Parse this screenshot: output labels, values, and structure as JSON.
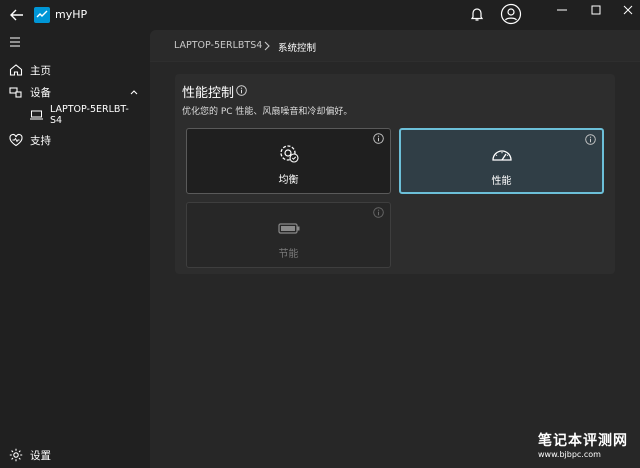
{
  "app": {
    "name": "myHP"
  },
  "sidebar": {
    "items": [
      {
        "label": "主页",
        "icon": "home-icon"
      },
      {
        "label": "设备",
        "icon": "devices-icon"
      },
      {
        "label": "支持",
        "icon": "support-heart-icon"
      }
    ],
    "device": {
      "label": "LAPTOP-5ERLBT-S4",
      "label_line1": "LAPTOP-5ERLBT-",
      "label_line2": "S4"
    },
    "settings_label": "设置"
  },
  "breadcrumb": {
    "device": "LAPTOP-5ERLBTS4",
    "current": "系统控制"
  },
  "panel": {
    "title": "性能控制",
    "subtitle": "优化您的 PC 性能、风扇噪音和冷却偏好。",
    "cards": [
      {
        "label": "均衡",
        "icon": "gear-check-icon",
        "state": "normal"
      },
      {
        "label": "性能",
        "icon": "speedometer-icon",
        "state": "selected"
      },
      {
        "label": "节能",
        "icon": "battery-icon",
        "state": "disabled"
      }
    ]
  },
  "watermark": {
    "title": "笔记本评测网",
    "url": "www.bjbpc.com"
  },
  "colors": {
    "accent": "#6cbfd8",
    "background": "#202020",
    "panel": "#2d2d2d"
  }
}
